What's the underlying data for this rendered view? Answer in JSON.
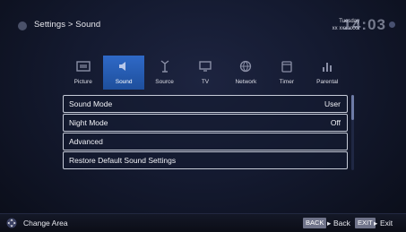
{
  "header": {
    "title": "Settings > Sound",
    "day": "Tuesday",
    "date": "xx xxx xxxx",
    "clock": "14:03"
  },
  "categories": [
    {
      "label": "Picture",
      "icon": "picture-icon"
    },
    {
      "label": "Sound",
      "icon": "sound-icon",
      "active": true
    },
    {
      "label": "Source",
      "icon": "antenna-icon"
    },
    {
      "label": "TV",
      "icon": "tv-icon"
    },
    {
      "label": "Network",
      "icon": "globe-icon"
    },
    {
      "label": "Timer",
      "icon": "timer-icon"
    },
    {
      "label": "Parental",
      "icon": "parental-icon"
    }
  ],
  "menu": {
    "items": [
      {
        "label": "Sound Mode",
        "value": "User"
      },
      {
        "label": "Night Mode",
        "value": "Off"
      },
      {
        "label": "Advanced",
        "value": ""
      },
      {
        "label": "Restore Default Sound Settings",
        "value": ""
      }
    ]
  },
  "footer": {
    "change_area": "Change Area",
    "back_key": "BACK",
    "back_label": "Back",
    "exit_key": "EXIT",
    "exit_label": "Exit"
  },
  "colors": {
    "active_tab": "#2f69c7",
    "background": "#141a30",
    "key_badge": "#70748a"
  }
}
